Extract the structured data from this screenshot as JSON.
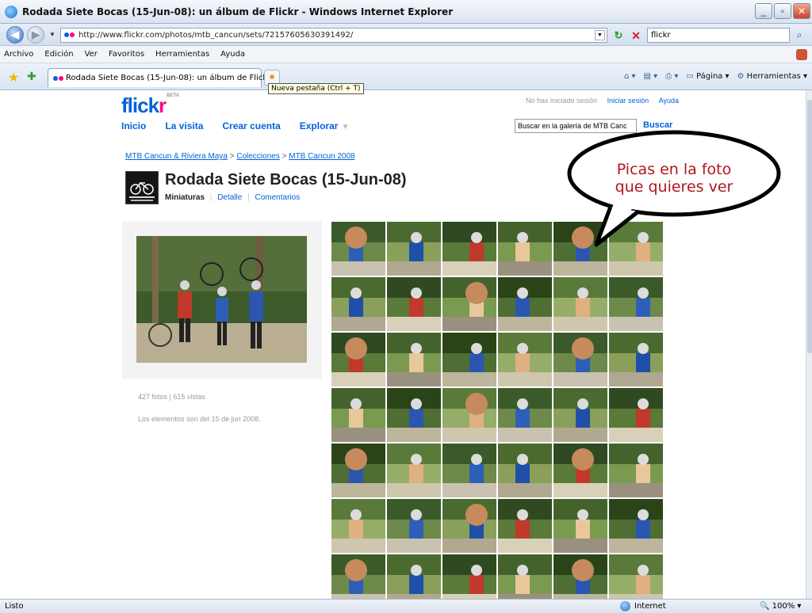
{
  "window": {
    "title": "Rodada Siete Bocas (15-Jun-08): un álbum de Flickr - Windows Internet Explorer",
    "controls": {
      "minimize": "_",
      "maximize": "▫",
      "close": "✕"
    }
  },
  "address_bar": {
    "url": "http://www.flickr.com/photos/mtb_cancun/sets/72157605630391492/",
    "search_value": "flickr"
  },
  "menu": [
    "Archivo",
    "Edición",
    "Ver",
    "Favoritos",
    "Herramientas",
    "Ayuda"
  ],
  "tabs": [
    {
      "label": "Rodada Siete Bocas (15-Jun-08): un álbum de Flickr"
    }
  ],
  "new_tab_tooltip": "Nueva pestaña (Ctrl + T)",
  "command_bar": {
    "page": "Página",
    "tools": "Herramientas"
  },
  "flickr": {
    "logo_a": "flickr",
    "logo_b": "",
    "beta": "BETA",
    "not_signed": "No has iniciado sesión",
    "sign_in": "Iniciar sesión",
    "help": "Ayuda",
    "nav": [
      "Inicio",
      "La visita",
      "Crear cuenta",
      "Explorar"
    ],
    "search_placeholder": "Buscar en la galería de MTB Canc",
    "search_button": "Buscar"
  },
  "breadcrumb": {
    "crumbs": [
      "MTB Cancun & Riviera Maya",
      "Colecciones",
      "MTB Cancun 2008"
    ],
    "separator": ">"
  },
  "set": {
    "title": "Rodada Siete Bocas (15-Jun-08)",
    "tabs": {
      "active": "Miniaturas",
      "detail": "Detalle",
      "comments": "Comentarios"
    },
    "stats": "427 fotos | 615 vistas",
    "dates": "Los elementos son del 15 de jun 2008."
  },
  "callout": {
    "line1": "Picas en la foto",
    "line2": "que quieres ver"
  },
  "status": {
    "left": "Listo",
    "zone": "Internet",
    "zoom": "100%"
  },
  "colors": {
    "flickr_blue": "#0063dc",
    "flickr_pink": "#ff0084",
    "callout_red": "#b4141e"
  }
}
